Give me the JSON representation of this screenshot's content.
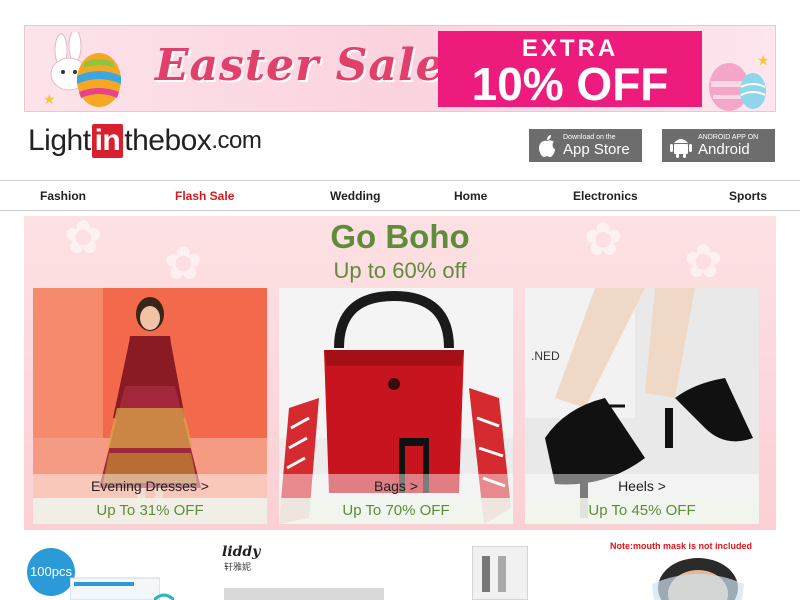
{
  "banner": {
    "headline": "Easter Sale",
    "extra_label": "EXTRA",
    "discount_label": "10% OFF"
  },
  "header": {
    "logo": {
      "part1": "Light",
      "part2": "in",
      "part3": "thebox",
      "part4": ".com"
    },
    "app_store": {
      "small": "Download on the",
      "big": "App Store"
    },
    "android": {
      "small": "ANDROID APP ON",
      "big": "Android"
    }
  },
  "nav": {
    "items": [
      {
        "label": "Fashion"
      },
      {
        "label": "Flash Sale"
      },
      {
        "label": "Wedding"
      },
      {
        "label": "Home"
      },
      {
        "label": "Electronics"
      },
      {
        "label": "Sports"
      }
    ]
  },
  "promo": {
    "title": "Go Boho",
    "subtitle": "Up to 60% off",
    "cards": [
      {
        "label": "Evening Dresses >",
        "offer": "Up To 31% OFF"
      },
      {
        "label": "Bags >",
        "offer": "Up To 70% OFF"
      },
      {
        "label": "Heels >",
        "offer": "Up To 45% OFF"
      }
    ]
  },
  "strip": {
    "badge": "100pcs",
    "brand": "liddy",
    "brand_sub": "轩雅妮",
    "mask_note": "Note:mouth mask is not included"
  },
  "colors": {
    "accent_pink": "#ec1b7c",
    "flash_sale_red": "#d8181b",
    "promo_green": "#5f8c3a",
    "logo_red": "#d8212f"
  }
}
